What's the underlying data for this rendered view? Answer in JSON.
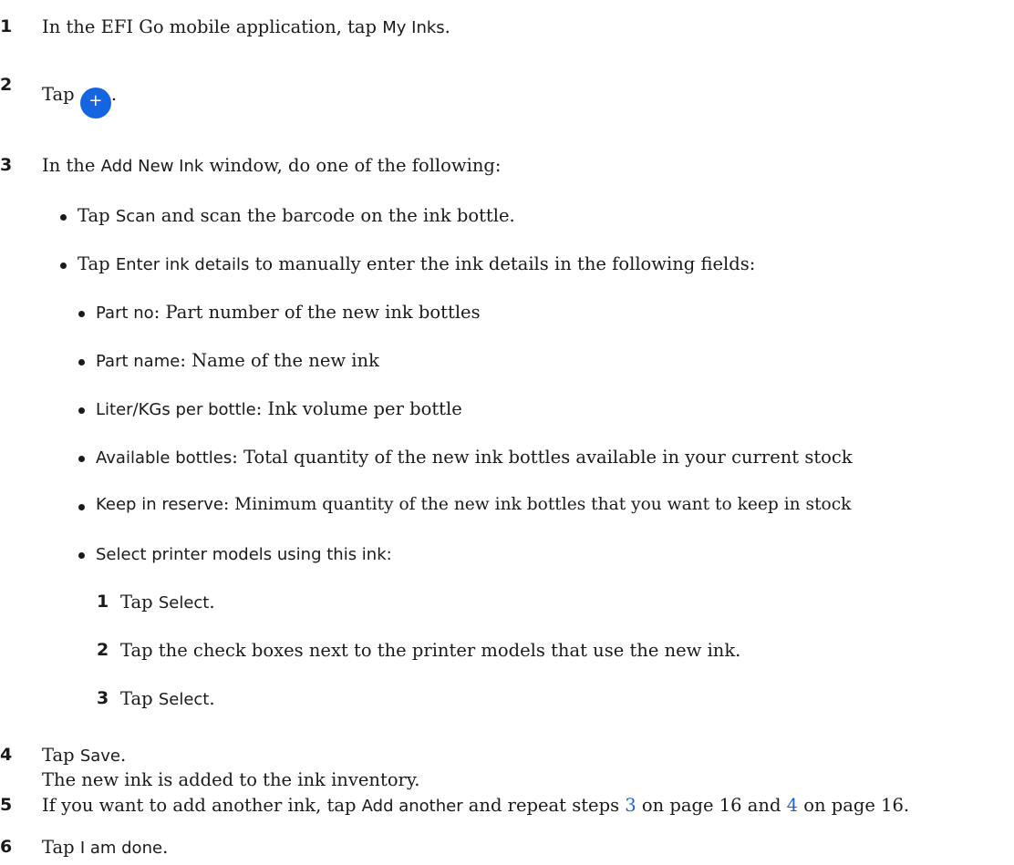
{
  "steps": [
    {
      "num": "1",
      "parts": [
        {
          "t": "In the EFI Go mobile application, tap ",
          "s": false
        },
        {
          "t": "My Inks",
          "s": true
        },
        {
          "t": ".",
          "s": false
        }
      ]
    },
    {
      "num": "2",
      "pre": "Tap",
      "icon_glyph": "+",
      "post": "."
    },
    {
      "num": "3",
      "parts": [
        {
          "t": "In the ",
          "s": false
        },
        {
          "t": "Add New Ink",
          "s": true
        },
        {
          "t": " window, do one of the following:",
          "s": false
        }
      ],
      "options": [
        {
          "parts": [
            {
              "t": "Tap ",
              "s": false
            },
            {
              "t": "Scan",
              "s": true
            },
            {
              "t": " and scan the barcode on the ink bottle.",
              "s": false
            }
          ]
        },
        {
          "parts": [
            {
              "t": "Tap ",
              "s": false
            },
            {
              "t": "Enter ink details",
              "s": true
            },
            {
              "t": " to manually enter the ink details in the following fields:",
              "s": false
            }
          ]
        }
      ],
      "fields": [
        {
          "label": "Part no",
          "desc": ": Part number of the new ink bottles"
        },
        {
          "label": "Part name",
          "desc": ": Name of the new ink"
        },
        {
          "label": "Liter/KGs per bottle",
          "desc": ": Ink volume per bottle"
        },
        {
          "label": "Available bottles",
          "desc": ": Total quantity of the new ink bottles available in your current stock"
        },
        {
          "label": "Keep in reserve",
          "desc": ": Minimum quantity of the new ink bottles that you want to keep in stock"
        },
        {
          "label": "Select printer models using this ink:",
          "desc": ""
        }
      ],
      "substeps": [
        {
          "num": "1",
          "parts": [
            {
              "t": "Tap ",
              "s": false
            },
            {
              "t": "Select",
              "s": true
            },
            {
              "t": ".",
              "s": false
            }
          ]
        },
        {
          "num": "2",
          "parts": [
            {
              "t": "Tap the check boxes next to the printer models that use the new ink.",
              "s": false
            }
          ]
        },
        {
          "num": "3",
          "parts": [
            {
              "t": "Tap ",
              "s": false
            },
            {
              "t": "Select",
              "s": true
            },
            {
              "t": ".",
              "s": false
            }
          ]
        }
      ]
    },
    {
      "num": "4",
      "parts": [
        {
          "t": "Tap ",
          "s": false
        },
        {
          "t": "Save",
          "s": true
        },
        {
          "t": ".",
          "s": false
        }
      ],
      "result": "The new ink is added to the ink inventory."
    },
    {
      "num": "5",
      "parts": [
        {
          "t": "If you want to add another ink, tap ",
          "s": false
        },
        {
          "t": "Add another",
          "s": true
        },
        {
          "t": " and repeat steps ",
          "s": false
        },
        {
          "t": "3",
          "s": false,
          "link": true
        },
        {
          "t": " on page 16 and ",
          "s": false
        },
        {
          "t": "4",
          "s": false,
          "link": true
        },
        {
          "t": " on page 16.",
          "s": false
        }
      ]
    },
    {
      "num": "6",
      "parts": [
        {
          "t": "Tap ",
          "s": false
        },
        {
          "t": "I am done",
          "s": true
        },
        {
          "t": ".",
          "s": false
        }
      ]
    }
  ]
}
